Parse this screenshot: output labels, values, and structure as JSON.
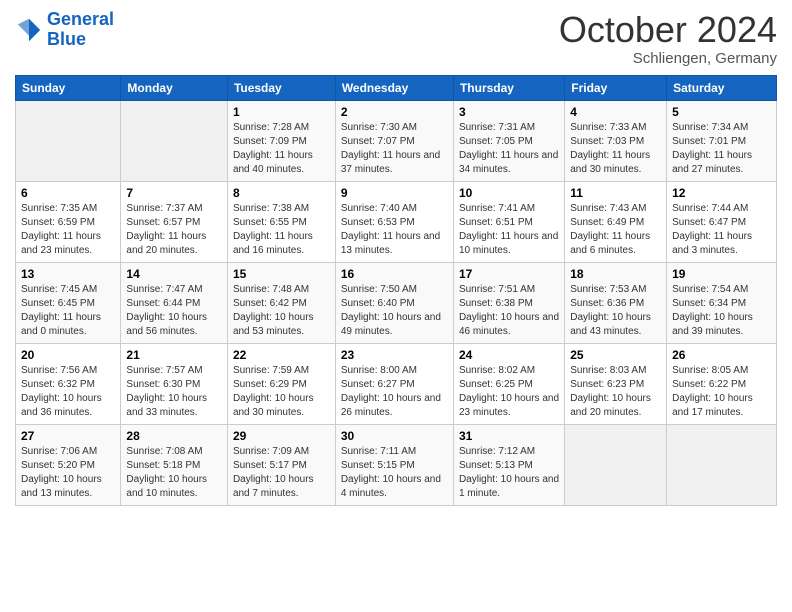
{
  "header": {
    "logo_line1": "General",
    "logo_line2": "Blue",
    "month_title": "October 2024",
    "subtitle": "Schliengen, Germany"
  },
  "weekdays": [
    "Sunday",
    "Monday",
    "Tuesday",
    "Wednesday",
    "Thursday",
    "Friday",
    "Saturday"
  ],
  "rows": [
    [
      {
        "day": "",
        "info": ""
      },
      {
        "day": "",
        "info": ""
      },
      {
        "day": "1",
        "info": "Sunrise: 7:28 AM\nSunset: 7:09 PM\nDaylight: 11 hours and 40 minutes."
      },
      {
        "day": "2",
        "info": "Sunrise: 7:30 AM\nSunset: 7:07 PM\nDaylight: 11 hours and 37 minutes."
      },
      {
        "day": "3",
        "info": "Sunrise: 7:31 AM\nSunset: 7:05 PM\nDaylight: 11 hours and 34 minutes."
      },
      {
        "day": "4",
        "info": "Sunrise: 7:33 AM\nSunset: 7:03 PM\nDaylight: 11 hours and 30 minutes."
      },
      {
        "day": "5",
        "info": "Sunrise: 7:34 AM\nSunset: 7:01 PM\nDaylight: 11 hours and 27 minutes."
      }
    ],
    [
      {
        "day": "6",
        "info": "Sunrise: 7:35 AM\nSunset: 6:59 PM\nDaylight: 11 hours and 23 minutes."
      },
      {
        "day": "7",
        "info": "Sunrise: 7:37 AM\nSunset: 6:57 PM\nDaylight: 11 hours and 20 minutes."
      },
      {
        "day": "8",
        "info": "Sunrise: 7:38 AM\nSunset: 6:55 PM\nDaylight: 11 hours and 16 minutes."
      },
      {
        "day": "9",
        "info": "Sunrise: 7:40 AM\nSunset: 6:53 PM\nDaylight: 11 hours and 13 minutes."
      },
      {
        "day": "10",
        "info": "Sunrise: 7:41 AM\nSunset: 6:51 PM\nDaylight: 11 hours and 10 minutes."
      },
      {
        "day": "11",
        "info": "Sunrise: 7:43 AM\nSunset: 6:49 PM\nDaylight: 11 hours and 6 minutes."
      },
      {
        "day": "12",
        "info": "Sunrise: 7:44 AM\nSunset: 6:47 PM\nDaylight: 11 hours and 3 minutes."
      }
    ],
    [
      {
        "day": "13",
        "info": "Sunrise: 7:45 AM\nSunset: 6:45 PM\nDaylight: 11 hours and 0 minutes."
      },
      {
        "day": "14",
        "info": "Sunrise: 7:47 AM\nSunset: 6:44 PM\nDaylight: 10 hours and 56 minutes."
      },
      {
        "day": "15",
        "info": "Sunrise: 7:48 AM\nSunset: 6:42 PM\nDaylight: 10 hours and 53 minutes."
      },
      {
        "day": "16",
        "info": "Sunrise: 7:50 AM\nSunset: 6:40 PM\nDaylight: 10 hours and 49 minutes."
      },
      {
        "day": "17",
        "info": "Sunrise: 7:51 AM\nSunset: 6:38 PM\nDaylight: 10 hours and 46 minutes."
      },
      {
        "day": "18",
        "info": "Sunrise: 7:53 AM\nSunset: 6:36 PM\nDaylight: 10 hours and 43 minutes."
      },
      {
        "day": "19",
        "info": "Sunrise: 7:54 AM\nSunset: 6:34 PM\nDaylight: 10 hours and 39 minutes."
      }
    ],
    [
      {
        "day": "20",
        "info": "Sunrise: 7:56 AM\nSunset: 6:32 PM\nDaylight: 10 hours and 36 minutes."
      },
      {
        "day": "21",
        "info": "Sunrise: 7:57 AM\nSunset: 6:30 PM\nDaylight: 10 hours and 33 minutes."
      },
      {
        "day": "22",
        "info": "Sunrise: 7:59 AM\nSunset: 6:29 PM\nDaylight: 10 hours and 30 minutes."
      },
      {
        "day": "23",
        "info": "Sunrise: 8:00 AM\nSunset: 6:27 PM\nDaylight: 10 hours and 26 minutes."
      },
      {
        "day": "24",
        "info": "Sunrise: 8:02 AM\nSunset: 6:25 PM\nDaylight: 10 hours and 23 minutes."
      },
      {
        "day": "25",
        "info": "Sunrise: 8:03 AM\nSunset: 6:23 PM\nDaylight: 10 hours and 20 minutes."
      },
      {
        "day": "26",
        "info": "Sunrise: 8:05 AM\nSunset: 6:22 PM\nDaylight: 10 hours and 17 minutes."
      }
    ],
    [
      {
        "day": "27",
        "info": "Sunrise: 7:06 AM\nSunset: 5:20 PM\nDaylight: 10 hours and 13 minutes."
      },
      {
        "day": "28",
        "info": "Sunrise: 7:08 AM\nSunset: 5:18 PM\nDaylight: 10 hours and 10 minutes."
      },
      {
        "day": "29",
        "info": "Sunrise: 7:09 AM\nSunset: 5:17 PM\nDaylight: 10 hours and 7 minutes."
      },
      {
        "day": "30",
        "info": "Sunrise: 7:11 AM\nSunset: 5:15 PM\nDaylight: 10 hours and 4 minutes."
      },
      {
        "day": "31",
        "info": "Sunrise: 7:12 AM\nSunset: 5:13 PM\nDaylight: 10 hours and 1 minute."
      },
      {
        "day": "",
        "info": ""
      },
      {
        "day": "",
        "info": ""
      }
    ]
  ]
}
